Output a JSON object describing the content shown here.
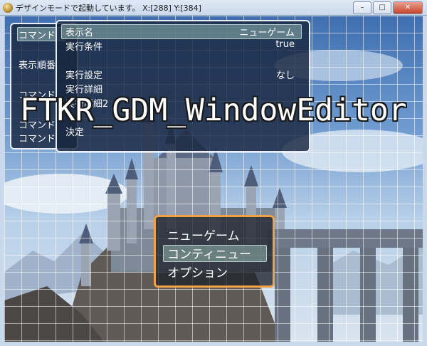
{
  "window": {
    "title": "デザインモードで起動しています。 X:[288] Y:[384]",
    "minimize": "–",
    "maximize": "□",
    "close": "✕",
    "icon": "rpg-maker-icon"
  },
  "overlay_title": "FTKR_GDM_WindowEditor",
  "left_window": {
    "items": [
      "コマンド",
      "表示順番",
      "コマンド",
      "コマンド",
      "コマンド"
    ]
  },
  "main_window": {
    "rows": [
      {
        "label": "表示名",
        "value": "ニューゲーム"
      },
      {
        "label": "実行条件",
        "value": "true"
      },
      {
        "label": "実行設定",
        "value": "なし"
      },
      {
        "label": "実行詳細",
        "value": ""
      },
      {
        "label": "実行詳細2",
        "value": ""
      },
      {
        "label": "決定",
        "value": ""
      }
    ],
    "selected_index": 0
  },
  "title_command_window": {
    "items": [
      "ニューゲーム",
      "コンティニュー",
      "オプション"
    ],
    "selected_index": 1,
    "border_color": "#f0a046"
  }
}
